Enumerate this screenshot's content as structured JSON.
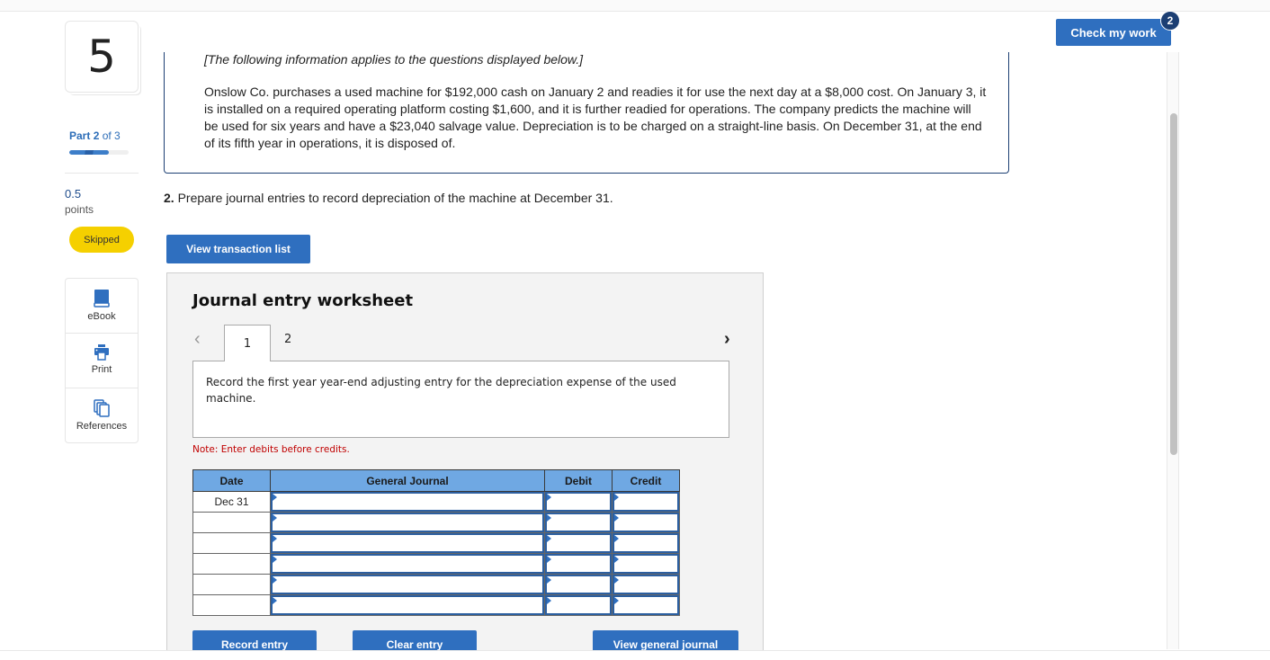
{
  "question_number": "5",
  "part": {
    "prefix": "Part",
    "current": "2",
    "suffix": "of 3",
    "progress_fraction": 0.667
  },
  "points": {
    "value": "0.5",
    "label": "points"
  },
  "status_badge": "Skipped",
  "tools": [
    {
      "label": "eBook",
      "icon": "book-icon"
    },
    {
      "label": "Print",
      "icon": "printer-icon"
    },
    {
      "label": "References",
      "icon": "copy-pages-icon"
    }
  ],
  "info": {
    "lead": "[The following information applies to the questions displayed below.]",
    "text": "Onslow Co. purchases a used machine for $192,000 cash on January 2 and readies it for use the next day at a $8,000 cost. On January 3, it is installed on a required operating platform costing $1,600, and it is further readied for operations. The company predicts the machine will be used for six years and have a $23,040 salvage value. Depreciation is to be charged on a straight-line basis. On December 31, at the end of its fifth year in operations, it is disposed of."
  },
  "question": {
    "number": "2.",
    "text": "Prepare journal entries to record depreciation of the machine at December 31."
  },
  "buttons": {
    "view_transaction_list": "View transaction list",
    "check_my_work": "Check my work",
    "check_badge": "2",
    "record_entry": "Record entry",
    "clear_entry": "Clear entry",
    "view_general_journal": "View general journal"
  },
  "worksheet": {
    "title": "Journal entry worksheet",
    "prev": "<",
    "next": ">",
    "tabs": [
      "1",
      "2"
    ],
    "active_tab": "1",
    "description": "Record the first year year-end adjusting entry for the depreciation expense of the used machine.",
    "note": "Note: Enter debits before credits.",
    "columns": [
      "Date",
      "General Journal",
      "Debit",
      "Credit"
    ],
    "rows": [
      {
        "date": "Dec 31",
        "account": "",
        "debit": "",
        "credit": ""
      },
      {
        "date": "",
        "account": "",
        "debit": "",
        "credit": ""
      },
      {
        "date": "",
        "account": "",
        "debit": "",
        "credit": ""
      },
      {
        "date": "",
        "account": "",
        "debit": "",
        "credit": ""
      },
      {
        "date": "",
        "account": "",
        "debit": "",
        "credit": ""
      },
      {
        "date": "",
        "account": "",
        "debit": "",
        "credit": ""
      }
    ]
  },
  "colors": {
    "primary": "#2f6fbf",
    "navy": "#1c3f73",
    "table_header": "#6fa8e3",
    "note_red": "#c00000",
    "skipped_yellow": "#f5d000"
  }
}
